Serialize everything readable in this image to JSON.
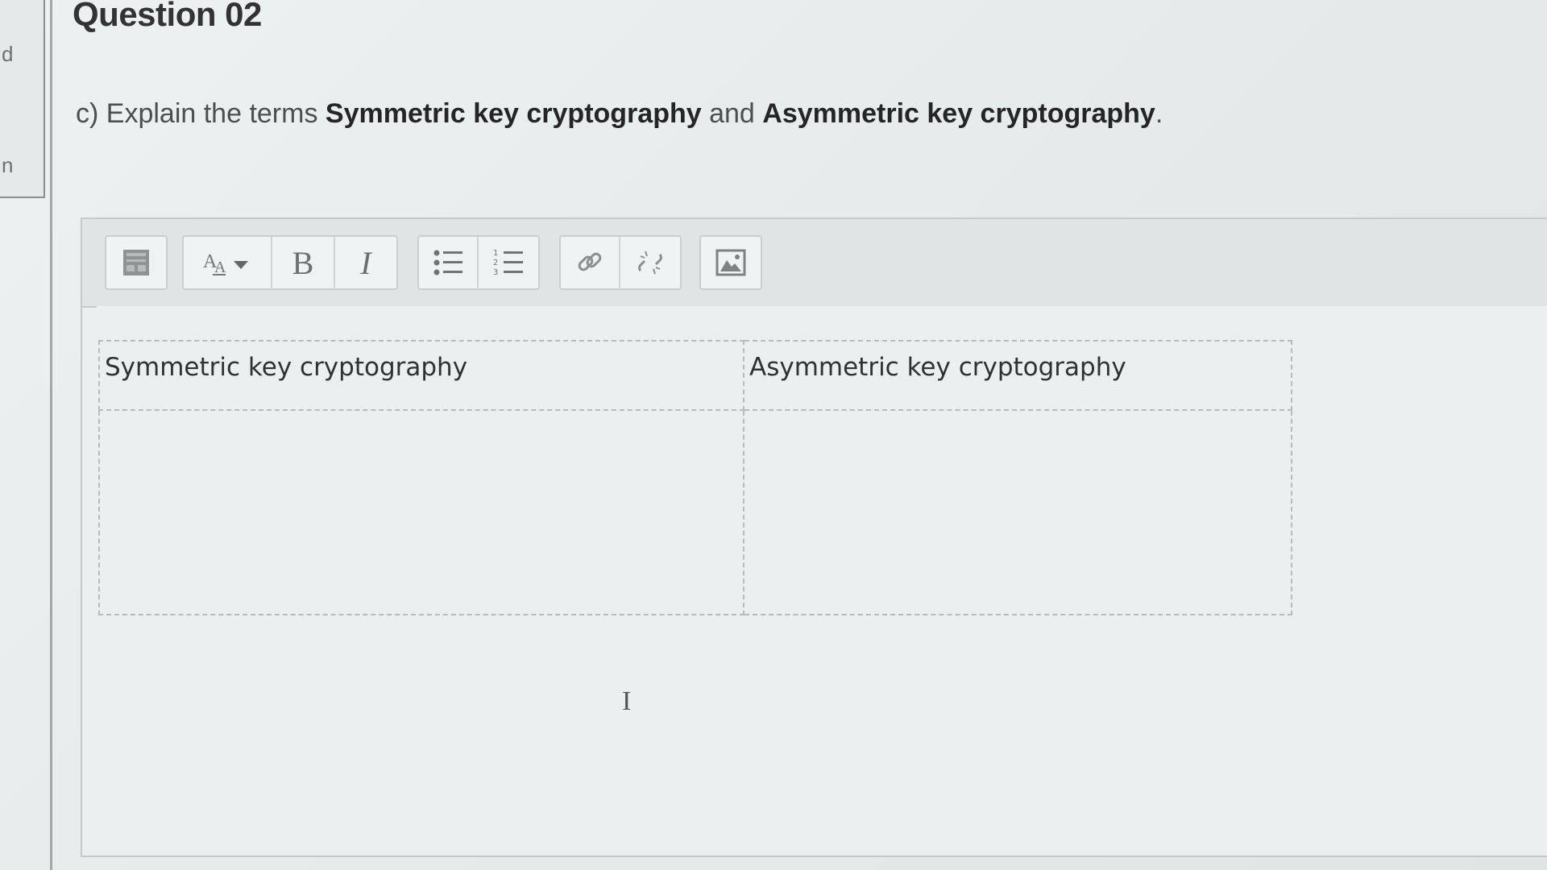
{
  "sidebar": {
    "letter_top": "d",
    "letter_bottom": "n"
  },
  "question": {
    "title": "Question 02",
    "prefix": "c) Explain the terms ",
    "term1": "Symmetric key cryptography",
    "connector": " and ",
    "term2": "Asymmetric key cryptography",
    "suffix": "."
  },
  "toolbar": {
    "groups": [
      {
        "name": "format-toggle",
        "icons": [
          "toolbar-toggle-icon"
        ]
      },
      {
        "name": "text",
        "icons": [
          "font-size-icon",
          "bold-icon",
          "italic-icon"
        ]
      },
      {
        "name": "lists",
        "icons": [
          "bullet-list-icon",
          "numbered-list-icon"
        ]
      },
      {
        "name": "links",
        "icons": [
          "link-icon",
          "unlink-icon"
        ]
      },
      {
        "name": "media",
        "icons": [
          "image-icon"
        ]
      }
    ],
    "bold_label": "B",
    "italic_label": "I"
  },
  "table": {
    "headers": [
      "Symmetric key cryptography",
      "Asymmetric key cryptography"
    ],
    "rows": [
      [
        "",
        ""
      ]
    ]
  }
}
